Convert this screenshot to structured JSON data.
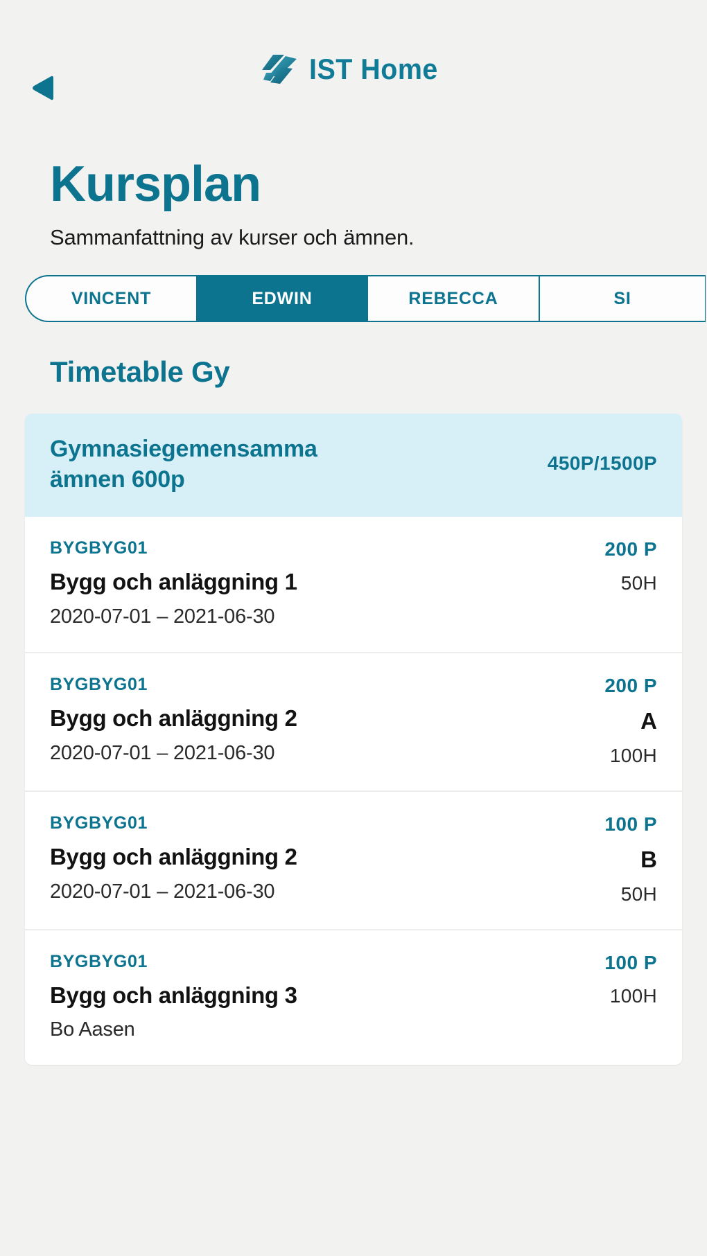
{
  "header": {
    "back_icon": "back-arrow-icon",
    "logo_icon": "ist-logo-icon",
    "brand_name": "IST Home"
  },
  "title": {
    "heading": "Kursplan",
    "subtitle": "Sammanfattning av kurser och ämnen."
  },
  "tabs": [
    {
      "label": "VINCENT",
      "active": false
    },
    {
      "label": "EDWIN",
      "active": true
    },
    {
      "label": "REBECCA",
      "active": false
    },
    {
      "label": "SI",
      "active": false
    }
  ],
  "section": {
    "heading": "Timetable Gy"
  },
  "card": {
    "header": {
      "title": "Gymnasiegemensamma ämnen 600p",
      "value": "450P/1500P"
    },
    "rows": [
      {
        "code": "BYGBYG01",
        "name": "Bygg och anläggning 1",
        "meta": "2020-07-01 – 2021-06-30",
        "points": "200 P",
        "grade": "",
        "hours": "50H"
      },
      {
        "code": "BYGBYG01",
        "name": "Bygg och anläggning 2",
        "meta": "2020-07-01 – 2021-06-30",
        "points": "200 P",
        "grade": "A",
        "hours": "100H"
      },
      {
        "code": "BYGBYG01",
        "name": "Bygg och anläggning 2",
        "meta": "2020-07-01 – 2021-06-30",
        "points": "100 P",
        "grade": "B",
        "hours": "50H"
      },
      {
        "code": "BYGBYG01",
        "name": "Bygg och anläggning 3",
        "meta": "Bo Aasen",
        "points": "100 P",
        "grade": "",
        "hours": "100H"
      }
    ]
  },
  "colors": {
    "accent": "#0d7490",
    "card_header_bg": "#d7eff6",
    "page_bg": "#f2f2f1",
    "text": "#121212"
  }
}
